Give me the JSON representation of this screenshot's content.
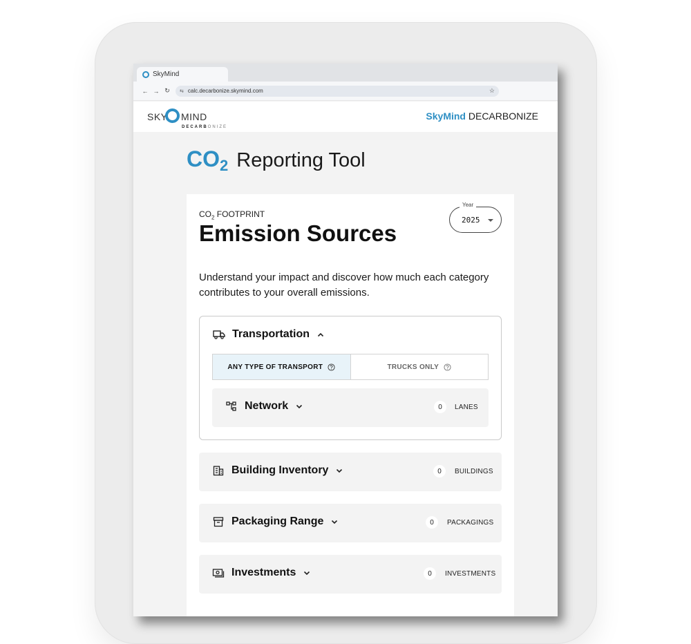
{
  "browser": {
    "tab_title": "SkyMind",
    "url": "calc.decarbonize.skymind.com"
  },
  "header": {
    "logo_sky": "SKY",
    "logo_mind": "MIND",
    "logo_sub_bold": "DECARB",
    "logo_sub_light": "ONIZE",
    "brand_accent": "SkyMind",
    "brand_rest": "DECARBONIZE"
  },
  "page": {
    "title_co": "CO",
    "title_sub": "2",
    "title_rest": "Reporting Tool"
  },
  "card": {
    "eyebrow_co": "CO",
    "eyebrow_sub": "2",
    "eyebrow_rest": "FOOTPRINT",
    "title": "Emission Sources",
    "year_label": "Year",
    "year_value": "2025",
    "intro": "Understand your impact and discover how much each category contributes to your overall emissions."
  },
  "transportation": {
    "label": "Transportation",
    "segment_any": "ANY TYPE OF TRANSPORT",
    "segment_trucks": "TRUCKS ONLY",
    "network": {
      "label": "Network",
      "count": "0",
      "unit": "LANES"
    }
  },
  "categories": [
    {
      "label": "Building Inventory",
      "count": "0",
      "unit": "BUILDINGS",
      "icon": "building-icon"
    },
    {
      "label": "Packaging Range",
      "count": "0",
      "unit": "PACKAGINGS",
      "icon": "archive-box-icon"
    },
    {
      "label": "Investments",
      "count": "0",
      "unit": "INVESTMENTS",
      "icon": "cash-icon"
    }
  ],
  "colors": {
    "accent": "#2e8fc4",
    "segment_active": "#e8f3f9"
  }
}
